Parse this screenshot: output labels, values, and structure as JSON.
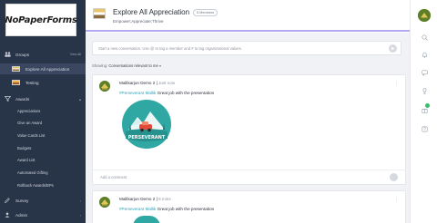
{
  "app": {
    "logo_text": "NoPaperForms"
  },
  "sidebar": {
    "groups_label": "Groups",
    "new_label": "View All",
    "group_items": [
      {
        "label": "Explore All Appreciation",
        "active": true
      },
      {
        "label": "Testing",
        "active": false
      }
    ],
    "awards_label": "Awards",
    "award_items": [
      "Appreciations",
      "Give an Award",
      "Value Cards List",
      "Budgets",
      "Award List",
      "Automated Gifting",
      "Rollback Awards/BPs"
    ],
    "survey_label": "Survey",
    "admin_label": "Admin"
  },
  "header": {
    "title": "Explore All Appreciation",
    "members_badge": "5 Members",
    "subtitle": "Empower;Appreciate;Thrive"
  },
  "composer": {
    "placeholder": "Start a new conversation. Use @ to tag a member and # to tag organizational values."
  },
  "filter": {
    "label": "Showing:",
    "value": "Conversations relevant to me"
  },
  "posts": [
    {
      "author": "Mallikarjun Demo 2",
      "time": "Just now",
      "hashtag": "#Perseverant",
      "mention": "Mallik",
      "text": "Great job with the presentation",
      "badge_label": "PERSEVERANT",
      "comment_placeholder": "Add a comment"
    },
    {
      "author": "Mallikarjun Demo 2",
      "time": "8 mins",
      "hashtag": "#Perseverant",
      "mention": "Mallik",
      "text": "Great job with the presentation"
    }
  ],
  "colors": {
    "sidebar_bg": "#283447",
    "accent_purple": "#b3aaf0",
    "link_teal": "#2d9fb5",
    "badge_teal": "#2fa8a4",
    "online_green": "#32c26b"
  },
  "rail_icons": [
    "search-icon",
    "bell-icon",
    "chat-icon",
    "trophy-icon",
    "gift-icon",
    "document-icon",
    "help-icon"
  ]
}
